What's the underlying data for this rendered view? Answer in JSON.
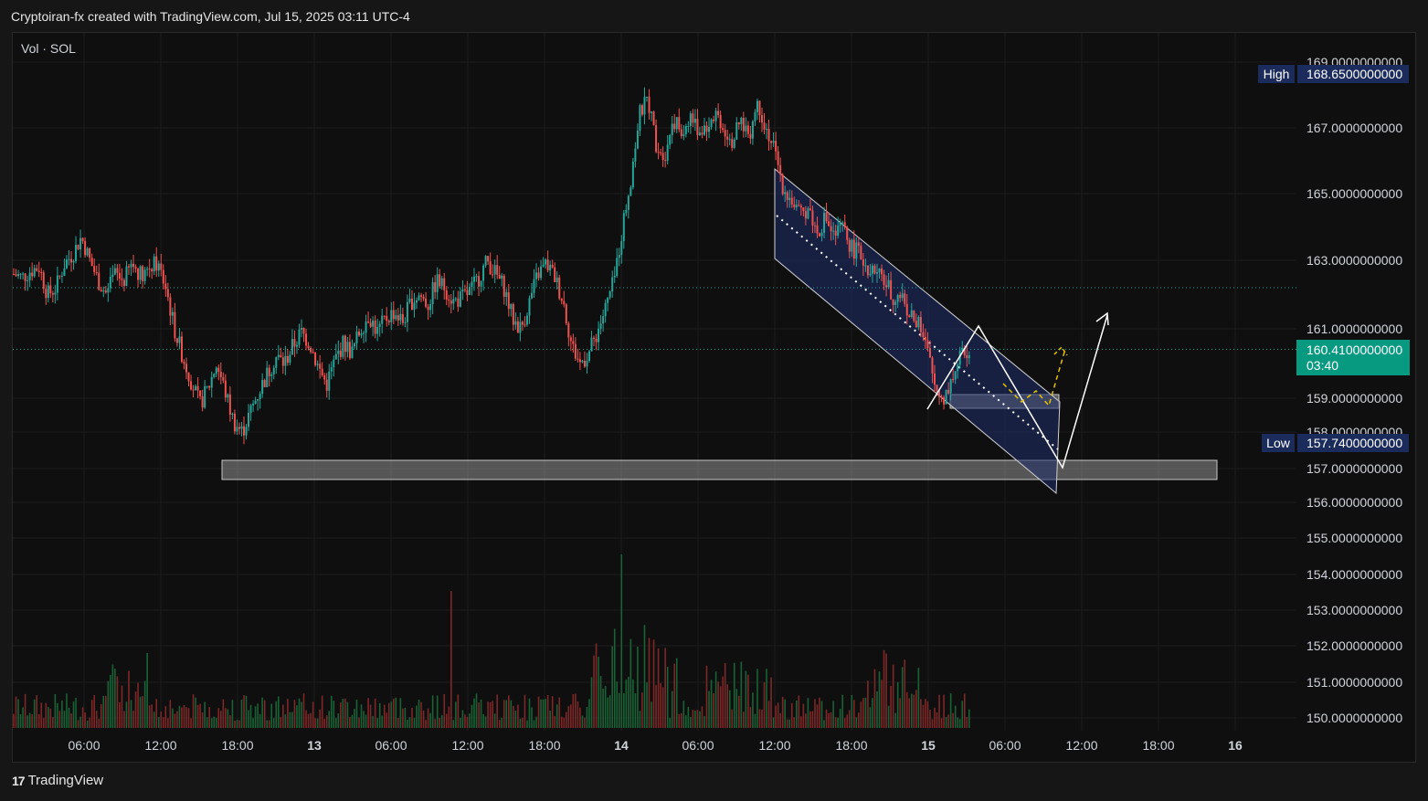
{
  "header": {
    "title": "Cryptoiran-fx created with TradingView.com, Jul 15, 2025 03:11 UTC-4"
  },
  "footer": {
    "brand": "TradingView",
    "logo_glyph": "17"
  },
  "chart_data": {
    "type": "candlestick",
    "title": "",
    "legend_label": "Vol · SOL",
    "price_axis": {
      "ticks": [
        "169.0000000000",
        "167.0000000000",
        "165.0000000000",
        "163.0000000000",
        "161.0000000000",
        "159.0000000000",
        "158.0000000000",
        "157.0000000000",
        "156.0000000000",
        "155.0000000000",
        "154.0000000000",
        "153.0000000000",
        "152.0000000000",
        "151.0000000000",
        "150.0000000000"
      ],
      "high_label": "High",
      "high_value": "168.6500000000",
      "low_label": "Low",
      "low_value": "157.7400000000",
      "last_value": "160.4100000000",
      "countdown": "03:40"
    },
    "time_axis": {
      "ticks": [
        "06:00",
        "12:00",
        "18:00",
        "13",
        "06:00",
        "12:00",
        "18:00",
        "14",
        "06:00",
        "12:00",
        "18:00",
        "15",
        "06:00",
        "12:00",
        "18:00",
        "16"
      ],
      "bold": [
        "13",
        "14",
        "15",
        "16"
      ]
    },
    "colors": {
      "up": "#26a69a",
      "down": "#ef5350",
      "last_price": "#089981",
      "label_bg": "#1a2b5c",
      "channel": "#1f2f6b"
    },
    "price_path": [
      162.6,
      162.5,
      162.7,
      162.8,
      162.0,
      162.2,
      162.9,
      163.2,
      163.7,
      163.0,
      162.4,
      162.0,
      162.6,
      162.4,
      162.9,
      162.6,
      162.8,
      162.9,
      162.2,
      161.0,
      160.2,
      159.5,
      158.8,
      159.3,
      160.0,
      159.2,
      158.3,
      158.0,
      158.6,
      159.2,
      159.7,
      160.2,
      160.0,
      160.5,
      160.9,
      160.6,
      159.9,
      159.4,
      160.1,
      160.6,
      160.3,
      161.0,
      161.4,
      160.9,
      161.3,
      161.5,
      161.2,
      161.8,
      162.0,
      161.7,
      162.4,
      162.2,
      161.8,
      161.9,
      162.1,
      162.5,
      163.0,
      162.6,
      162.2,
      161.3,
      161.0,
      161.8,
      162.6,
      162.9,
      162.5,
      161.8,
      160.5,
      160.0,
      160.3,
      160.9,
      161.6,
      162.4,
      164.0,
      165.5,
      167.4,
      167.9,
      166.5,
      166.2,
      167.3,
      166.8,
      167.4,
      166.9,
      167.1,
      167.5,
      167.0,
      166.6,
      167.2,
      166.8,
      167.8,
      167.0,
      166.3,
      165.2,
      164.8,
      164.3,
      164.6,
      163.8,
      164.3,
      163.7,
      164.0,
      163.4,
      163.2,
      162.8,
      162.6,
      162.4,
      161.9,
      162.0,
      161.4,
      161.1,
      160.4,
      159.3,
      159.0,
      159.6,
      160.2,
      160.4
    ]
  }
}
